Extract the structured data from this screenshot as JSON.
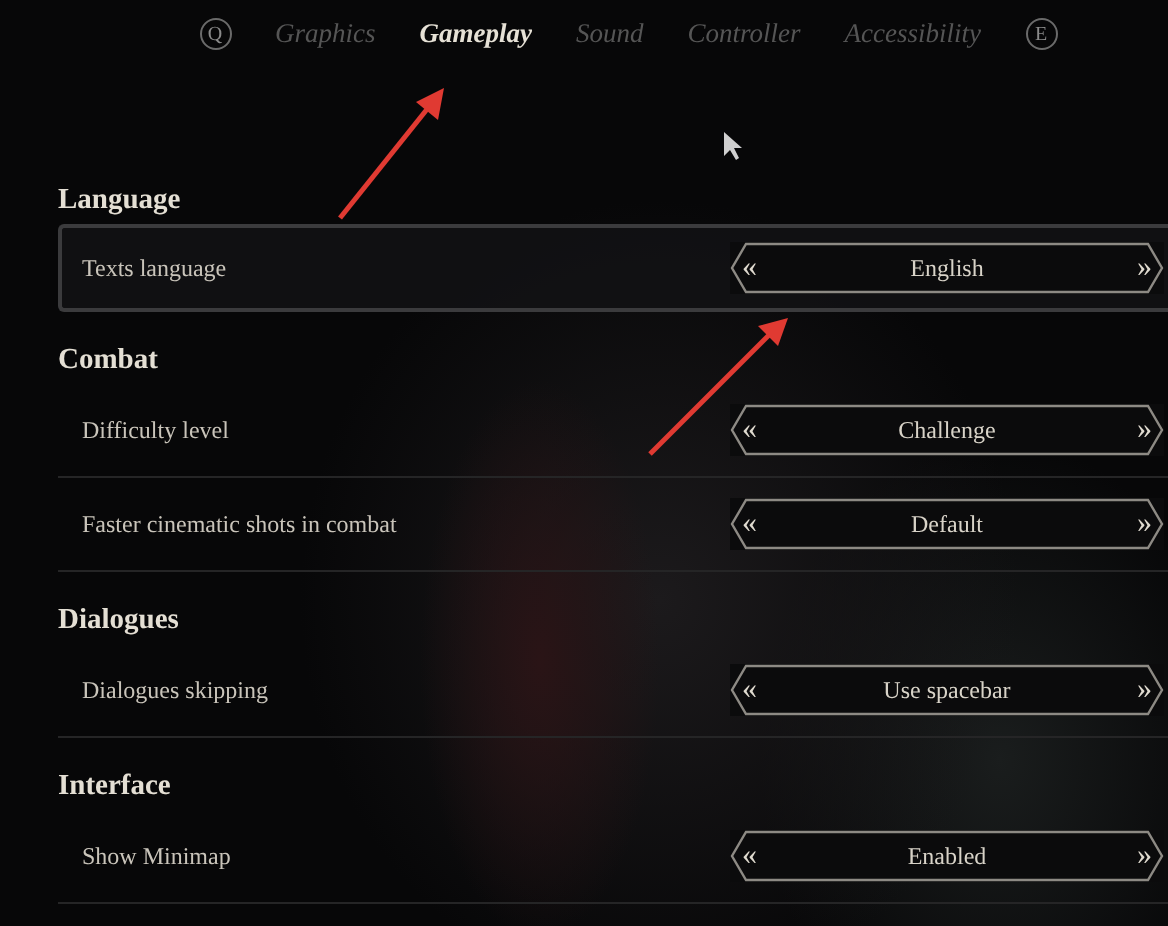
{
  "tab_keys": {
    "left": "Q",
    "right": "E"
  },
  "tabs": [
    {
      "label": "Graphics",
      "selected": false
    },
    {
      "label": "Gameplay",
      "selected": true
    },
    {
      "label": "Sound",
      "selected": false
    },
    {
      "label": "Controller",
      "selected": false
    },
    {
      "label": "Accessibility",
      "selected": false
    }
  ],
  "sections": [
    {
      "title": "Language",
      "settings": [
        {
          "label": "Texts language",
          "value": "English",
          "prev": "«",
          "next": "»",
          "selected": true
        }
      ]
    },
    {
      "title": "Combat",
      "settings": [
        {
          "label": "Difficulty level",
          "value": "Challenge",
          "prev": "«",
          "next": "»",
          "selected": false
        },
        {
          "label": "Faster cinematic shots in combat",
          "value": "Default",
          "prev": "«",
          "next": "»",
          "selected": false
        }
      ]
    },
    {
      "title": "Dialogues",
      "settings": [
        {
          "label": "Dialogues skipping",
          "value": "Use spacebar",
          "prev": "«",
          "next": "»",
          "selected": false
        }
      ]
    },
    {
      "title": "Interface",
      "settings": [
        {
          "label": "Show Minimap",
          "value": "Enabled",
          "prev": "«",
          "next": "»",
          "selected": false
        }
      ]
    }
  ]
}
